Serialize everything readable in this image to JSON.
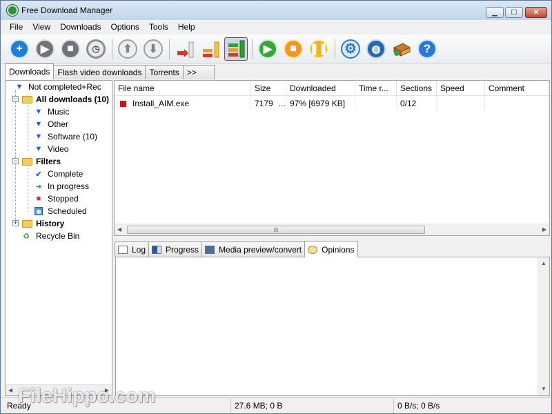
{
  "window": {
    "title": "Free Download Manager"
  },
  "window_buttons": [
    "minimize",
    "maximize",
    "close"
  ],
  "menu": [
    "File",
    "View",
    "Downloads",
    "Options",
    "Tools",
    "Help"
  ],
  "toolbar": [
    {
      "name": "add-download-button",
      "icon": "plus-icon",
      "color": "#1e7fd9"
    },
    {
      "name": "start-button",
      "icon": "play-icon",
      "color": "#6f747a"
    },
    {
      "name": "stop-button",
      "icon": "stop-icon",
      "color": "#6f747a"
    },
    {
      "name": "scheduler-button",
      "icon": "alarm-clock-icon",
      "color": "#8a8d92"
    },
    {
      "name": "move-up-button",
      "icon": "arrow-up-icon",
      "color": "#9aa0a7"
    },
    {
      "name": "move-down-button",
      "icon": "arrow-down-icon",
      "color": "#9aa0a7"
    },
    {
      "name": "speed-low-button",
      "icon": "speed-low-icon",
      "color": "#d23a2a"
    },
    {
      "name": "speed-medium-button",
      "icon": "speed-medium-icon",
      "color": "#f0a020"
    },
    {
      "name": "speed-high-button",
      "icon": "speed-high-icon",
      "color": "#2e9c3b"
    },
    {
      "name": "start-all-button",
      "icon": "start-all-icon",
      "color": "#3aa53a"
    },
    {
      "name": "stop-all-button",
      "icon": "stop-all-icon",
      "color": "#f09a1c"
    },
    {
      "name": "pause-all-button",
      "icon": "pause-all-icon",
      "color": "#f2b41e"
    },
    {
      "name": "settings-button",
      "icon": "gear-icon",
      "color": "#2f7bc4"
    },
    {
      "name": "site-manager-button",
      "icon": "globe-icon",
      "color": "#2866b0"
    },
    {
      "name": "community-button",
      "icon": "book-icon",
      "color": "#b56d1e"
    },
    {
      "name": "help-button",
      "icon": "question-icon",
      "color": "#2a7ad2"
    }
  ],
  "tabs": [
    "Downloads",
    "Flash video downloads",
    "Torrents",
    ">>"
  ],
  "tree": [
    {
      "label": "Not completed+Rec",
      "icon": "download-arrow-icon"
    },
    {
      "label": "All downloads (10)",
      "icon": "folder-icon"
    },
    {
      "label": "Music",
      "icon": "download-arrow-icon"
    },
    {
      "label": "Other",
      "icon": "download-arrow-icon"
    },
    {
      "label": "Software (10)",
      "icon": "download-arrow-icon"
    },
    {
      "label": "Video",
      "icon": "download-arrow-icon"
    },
    {
      "label": "Filters",
      "icon": "folder-icon"
    },
    {
      "label": "Complete",
      "icon": "checkmark-icon"
    },
    {
      "label": "In progress",
      "icon": "green-arrow-icon"
    },
    {
      "label": "Stopped",
      "icon": "red-square-icon"
    },
    {
      "label": "Scheduled",
      "icon": "calendar-icon"
    },
    {
      "label": "History",
      "icon": "folder-icon"
    },
    {
      "label": "Recycle Bin",
      "icon": "recycle-bin-icon"
    }
  ],
  "list": {
    "columns": [
      "File name",
      "Size",
      "Downloaded",
      "Time r...",
      "Sections",
      "Speed",
      "Comment"
    ],
    "rows": [
      {
        "name": "Install_AIM.exe",
        "size": "7179",
        "size_more": "...",
        "downloaded": "97% [6979 KB]",
        "time": "",
        "sections": "0/12",
        "speed": "",
        "comment": "",
        "status_color": "#cc1111"
      }
    ],
    "scroll_thumb": "III"
  },
  "bottom_tabs": [
    {
      "label": "Log",
      "icon": "log-icon"
    },
    {
      "label": "Progress",
      "icon": "progress-icon"
    },
    {
      "label": "Media preview/convert",
      "icon": "media-icon"
    },
    {
      "label": "Opinions",
      "icon": "opinions-icon"
    }
  ],
  "status": {
    "left": "Ready",
    "mid": "27.6 MB; 0 B",
    "right": "0 B/s; 0 B/s"
  },
  "watermark": "FileHippo.com"
}
